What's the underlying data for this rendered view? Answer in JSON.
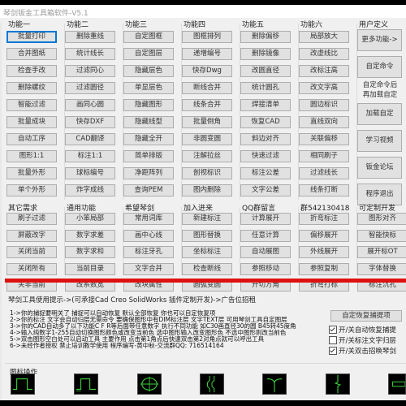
{
  "window": {
    "title": "琴剑钣金工具箱软件-V5.1"
  },
  "top_groups": [
    {
      "header": "功能一",
      "buttons": [
        "批量打印",
        "合并图纸",
        "检查手改",
        "删除螺纹",
        "智能过滤",
        "批量成块",
        "自动工序",
        "图形1:1",
        "批量外形",
        "单个外形"
      ]
    },
    {
      "header": "功能二",
      "buttons": [
        "删除重线",
        "统计线长",
        "过滤同心",
        "过滤圆径",
        "画同心圆",
        "快存DXF",
        "CAD翻译",
        "标注1:1",
        "球标编号",
        "炸字成线"
      ]
    },
    {
      "header": "功能三",
      "buttons": [
        "自定图框",
        "自定图层",
        "隐藏层色",
        "单显层色",
        "隐藏图形",
        "隐藏线型",
        "隐藏全开",
        "简单排版",
        "净距阵列",
        "查询PEM"
      ]
    },
    {
      "header": "功能四",
      "buttons": [
        "图框排列",
        "递增编号",
        "快存Dwg",
        "断线合并",
        "线条合并",
        "批量倒角",
        "非圆变圆",
        "注解拉丝",
        "剖视标识",
        "图内删除"
      ]
    },
    {
      "header": "功能五",
      "buttons": [
        "删除偏移",
        "删除镜像",
        "改圆直径",
        "统计圆孔",
        "焊接清单",
        "恢复CAD",
        "斜边对齐",
        "快速过滤",
        "标注公差",
        "文字公差"
      ]
    },
    {
      "header": "功能六",
      "buttons": [
        "局部放大",
        "改虚线比",
        "改标注高",
        "改文字高",
        "圆边标识",
        "直线双向",
        "关联偏移",
        "相同刷子",
        "过滤线长",
        "线条打断"
      ]
    }
  ],
  "user_defined": {
    "header": "用户定义",
    "more_label": "更多功能->",
    "custom_cmd_label": "自定命令",
    "custom_note": [
      "自定命令后",
      "再加载自定"
    ],
    "load_custom_label": "加载自定",
    "learn_video_label": "学习视频",
    "forum_label": "钣金论坛",
    "exit_label": "程序退出"
  },
  "bottom_groups": [
    {
      "header": "其它需求",
      "buttons": [
        "刷子过滤",
        "屏蔽改字",
        "关闭当前",
        "关闭所有",
        "关非当前"
      ]
    },
    {
      "header": "通用功能",
      "buttons": [
        "小笨局部",
        "数字求差",
        "数字求和",
        "当前目录",
        "改系数宽"
      ]
    },
    {
      "header": "希望琴剑",
      "buttons": [
        "常用词库",
        "画中心线",
        "标注牙孔",
        "文字合并",
        "改块属性"
      ]
    },
    {
      "header": "加入进来",
      "buttons": [
        "新建标注",
        "图形替换",
        "坐标标注",
        "检查断线",
        "圆弧变圆"
      ]
    },
    {
      "header": "QQ群留言",
      "buttons": [
        "计算展开",
        "任意计算",
        "自动展图",
        "参照移动",
        "开切方角"
      ]
    },
    {
      "header": "群542130418",
      "buttons": [
        "折弯标注",
        "偏移展开",
        "外线展开",
        "参照复制",
        "折弯打标"
      ]
    },
    {
      "header": "可定制开发",
      "buttons": [
        "图形对齐",
        "智能快标",
        "展开标OT",
        "字体替换",
        "标注沉孔"
      ]
    }
  ],
  "tips": {
    "header": "琴剑工具使用提示->(可承接Cad Creo SolidWorks 插件定制开发)->广告位招租",
    "lines": [
      "1->你的捕捉要明关了 捕捉可以自动恢复 默认全部恢复 你也可以自定恢复项",
      "2->你的标注 文字会自动归层无需命令 要确保图形中有DIM标注层 文字TEXT层 可用琴剑工具自定图层",
      "3->你的CAD自动多了以下功能C F R等后面带任意数字 执行不同功能 如C30画直径30的圆 B45转45度角",
      "4->输入纯数字1-255自动切换图形颜色或改变当前色 选中图形输入改变图形色 不选中图形则改当前色",
      "5->双击图形空白处可以启动工具 主要作用 点击第1角点后快速双击第2对角点就可以呼出工具",
      "6->未经作者授权 禁止培训教学使用 程序编写-黄中秋-交流群QQ: 716514164"
    ],
    "restore_button": "自定恢复捕提项",
    "checkboxes": [
      {
        "label": "开/关自动恢复捕提",
        "checked": true
      },
      {
        "label": "开/关标注文字归层",
        "checked": false
      },
      {
        "label": "开/关双击招唤琴剑",
        "checked": true
      }
    ]
  },
  "icons": {
    "header": "图标操作",
    "items": [
      "pulse-wave-icon",
      "pulse-wave-alt-icon",
      "circle-crosshair-icon",
      "break-line-icon",
      "y-junction-icon",
      "zigzag-break-icon",
      "slot-rect-icon"
    ],
    "stroke_color": "#3ccf3c"
  },
  "colors": {
    "accent_red": "#e01010",
    "focus_blue": "#0078d7"
  }
}
